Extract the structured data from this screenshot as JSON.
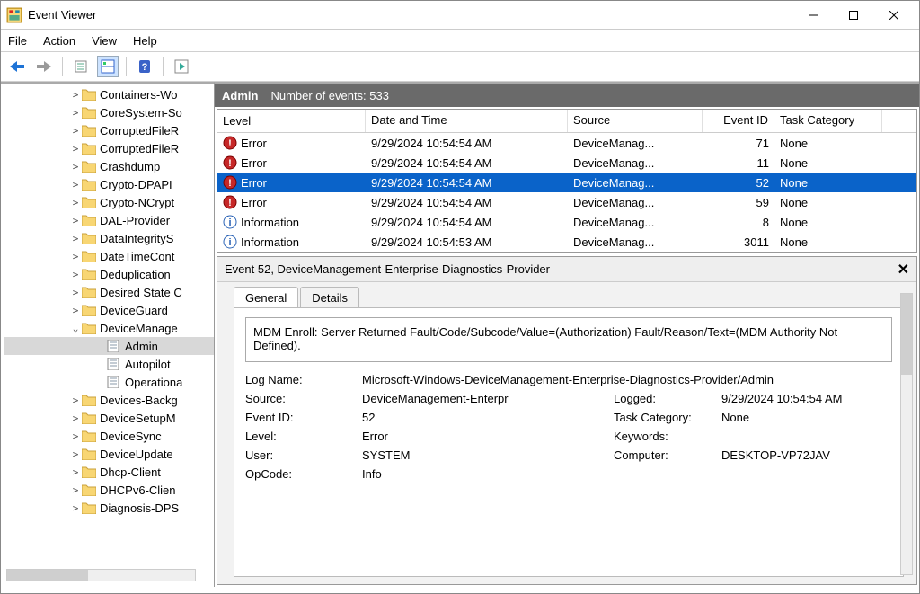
{
  "window": {
    "title": "Event Viewer"
  },
  "menu": [
    "File",
    "Action",
    "View",
    "Help"
  ],
  "tree": {
    "items": [
      {
        "ind": 72,
        "exp": ">",
        "label": "Containers-Wo",
        "type": "folder"
      },
      {
        "ind": 72,
        "exp": ">",
        "label": "CoreSystem-So",
        "type": "folder"
      },
      {
        "ind": 72,
        "exp": ">",
        "label": "CorruptedFileR",
        "type": "folder"
      },
      {
        "ind": 72,
        "exp": ">",
        "label": "CorruptedFileR",
        "type": "folder"
      },
      {
        "ind": 72,
        "exp": ">",
        "label": "Crashdump",
        "type": "folder"
      },
      {
        "ind": 72,
        "exp": ">",
        "label": "Crypto-DPAPI",
        "type": "folder"
      },
      {
        "ind": 72,
        "exp": ">",
        "label": "Crypto-NCrypt",
        "type": "folder"
      },
      {
        "ind": 72,
        "exp": ">",
        "label": "DAL-Provider",
        "type": "folder"
      },
      {
        "ind": 72,
        "exp": ">",
        "label": "DataIntegrityS",
        "type": "folder"
      },
      {
        "ind": 72,
        "exp": ">",
        "label": "DateTimeCont",
        "type": "folder"
      },
      {
        "ind": 72,
        "exp": ">",
        "label": "Deduplication",
        "type": "folder"
      },
      {
        "ind": 72,
        "exp": ">",
        "label": "Desired State C",
        "type": "folder"
      },
      {
        "ind": 72,
        "exp": ">",
        "label": "DeviceGuard",
        "type": "folder"
      },
      {
        "ind": 72,
        "exp": "v",
        "label": "DeviceManage",
        "type": "folder"
      },
      {
        "ind": 100,
        "exp": "",
        "label": "Admin",
        "type": "log",
        "sel": true
      },
      {
        "ind": 100,
        "exp": "",
        "label": "Autopilot",
        "type": "log"
      },
      {
        "ind": 100,
        "exp": "",
        "label": "Operationa",
        "type": "log"
      },
      {
        "ind": 72,
        "exp": ">",
        "label": "Devices-Backg",
        "type": "folder"
      },
      {
        "ind": 72,
        "exp": ">",
        "label": "DeviceSetupM",
        "type": "folder"
      },
      {
        "ind": 72,
        "exp": ">",
        "label": "DeviceSync",
        "type": "folder"
      },
      {
        "ind": 72,
        "exp": ">",
        "label": "DeviceUpdate",
        "type": "folder"
      },
      {
        "ind": 72,
        "exp": ">",
        "label": "Dhcp-Client",
        "type": "folder"
      },
      {
        "ind": 72,
        "exp": ">",
        "label": "DHCPv6-Clien",
        "type": "folder"
      },
      {
        "ind": 72,
        "exp": ">",
        "label": "Diagnosis-DPS",
        "type": "folder"
      }
    ]
  },
  "header": {
    "category": "Admin",
    "count_label": "Number of events: 533"
  },
  "columns": {
    "level": "Level",
    "date": "Date and Time",
    "source": "Source",
    "id": "Event ID",
    "task": "Task Category"
  },
  "events": [
    {
      "icon": "error",
      "level": "Error",
      "date": "9/29/2024 10:54:54 AM",
      "source": "DeviceManag...",
      "id": "71",
      "task": "None"
    },
    {
      "icon": "error",
      "level": "Error",
      "date": "9/29/2024 10:54:54 AM",
      "source": "DeviceManag...",
      "id": "11",
      "task": "None"
    },
    {
      "icon": "error",
      "level": "Error",
      "date": "9/29/2024 10:54:54 AM",
      "source": "DeviceManag...",
      "id": "52",
      "task": "None",
      "sel": true
    },
    {
      "icon": "error",
      "level": "Error",
      "date": "9/29/2024 10:54:54 AM",
      "source": "DeviceManag...",
      "id": "59",
      "task": "None"
    },
    {
      "icon": "info",
      "level": "Information",
      "date": "9/29/2024 10:54:54 AM",
      "source": "DeviceManag...",
      "id": "8",
      "task": "None"
    },
    {
      "icon": "info",
      "level": "Information",
      "date": "9/29/2024 10:54:53 AM",
      "source": "DeviceManag...",
      "id": "3011",
      "task": "None"
    }
  ],
  "detail": {
    "title": "Event 52, DeviceManagement-Enterprise-Diagnostics-Provider",
    "tabs": {
      "general": "General",
      "details": "Details"
    },
    "message": "MDM Enroll: Server Returned Fault/Code/Subcode/Value=(Authorization) Fault/Reason/Text=(MDM Authority Not Defined).",
    "labels": {
      "logname": "Log Name:",
      "source": "Source:",
      "eventid": "Event ID:",
      "level": "Level:",
      "user": "User:",
      "opcode": "OpCode:",
      "logged": "Logged:",
      "taskcat": "Task Category:",
      "keywords": "Keywords:",
      "computer": "Computer:"
    },
    "values": {
      "logname": "Microsoft-Windows-DeviceManagement-Enterprise-Diagnostics-Provider/Admin",
      "source": "DeviceManagement-Enterpr",
      "eventid": "52",
      "level": "Error",
      "user": "SYSTEM",
      "opcode": "Info",
      "logged": "9/29/2024 10:54:54 AM",
      "taskcat": "None",
      "keywords": "",
      "computer": "DESKTOP-VP72JAV"
    }
  }
}
